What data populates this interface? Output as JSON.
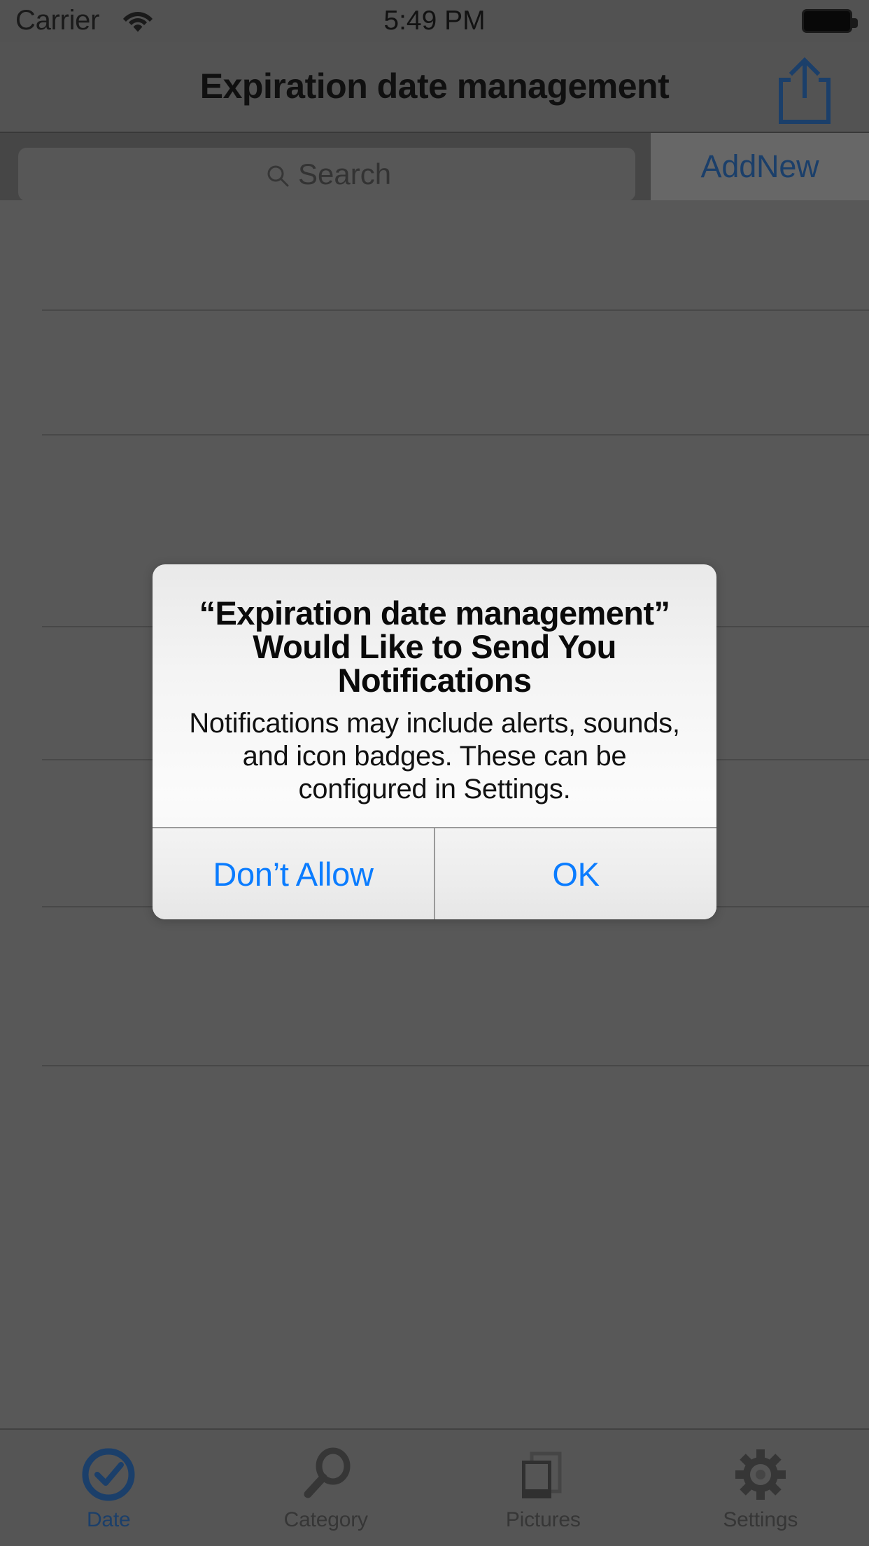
{
  "status_bar": {
    "carrier": "Carrier",
    "time": "5:49 PM",
    "wifi_icon": "wifi-icon",
    "battery_icon": "battery-full-icon"
  },
  "nav_bar": {
    "title": "Expiration date management",
    "share_icon": "share-icon"
  },
  "search": {
    "placeholder": "Search",
    "value": "",
    "icon": "search-icon",
    "add_new_label": "AddNew"
  },
  "tab_bar": {
    "items": [
      {
        "label": "Date",
        "icon": "check-circle-icon",
        "active": true
      },
      {
        "label": "Category",
        "icon": "magnifier-icon",
        "active": false
      },
      {
        "label": "Pictures",
        "icon": "photos-stack-icon",
        "active": false
      },
      {
        "label": "Settings",
        "icon": "gear-icon",
        "active": false
      }
    ]
  },
  "alert": {
    "title": "“Expiration date management” Would Like to Send You Notifications",
    "message": "Notifications may include alerts, sounds, and icon badges. These can be configured in Settings.",
    "buttons": [
      {
        "label": "Don’t Allow"
      },
      {
        "label": "OK"
      }
    ]
  },
  "colors": {
    "ios_blue": "#0a7cff",
    "dimmed_blue": "#1d4371",
    "dim_background": "#5e5e5e"
  }
}
